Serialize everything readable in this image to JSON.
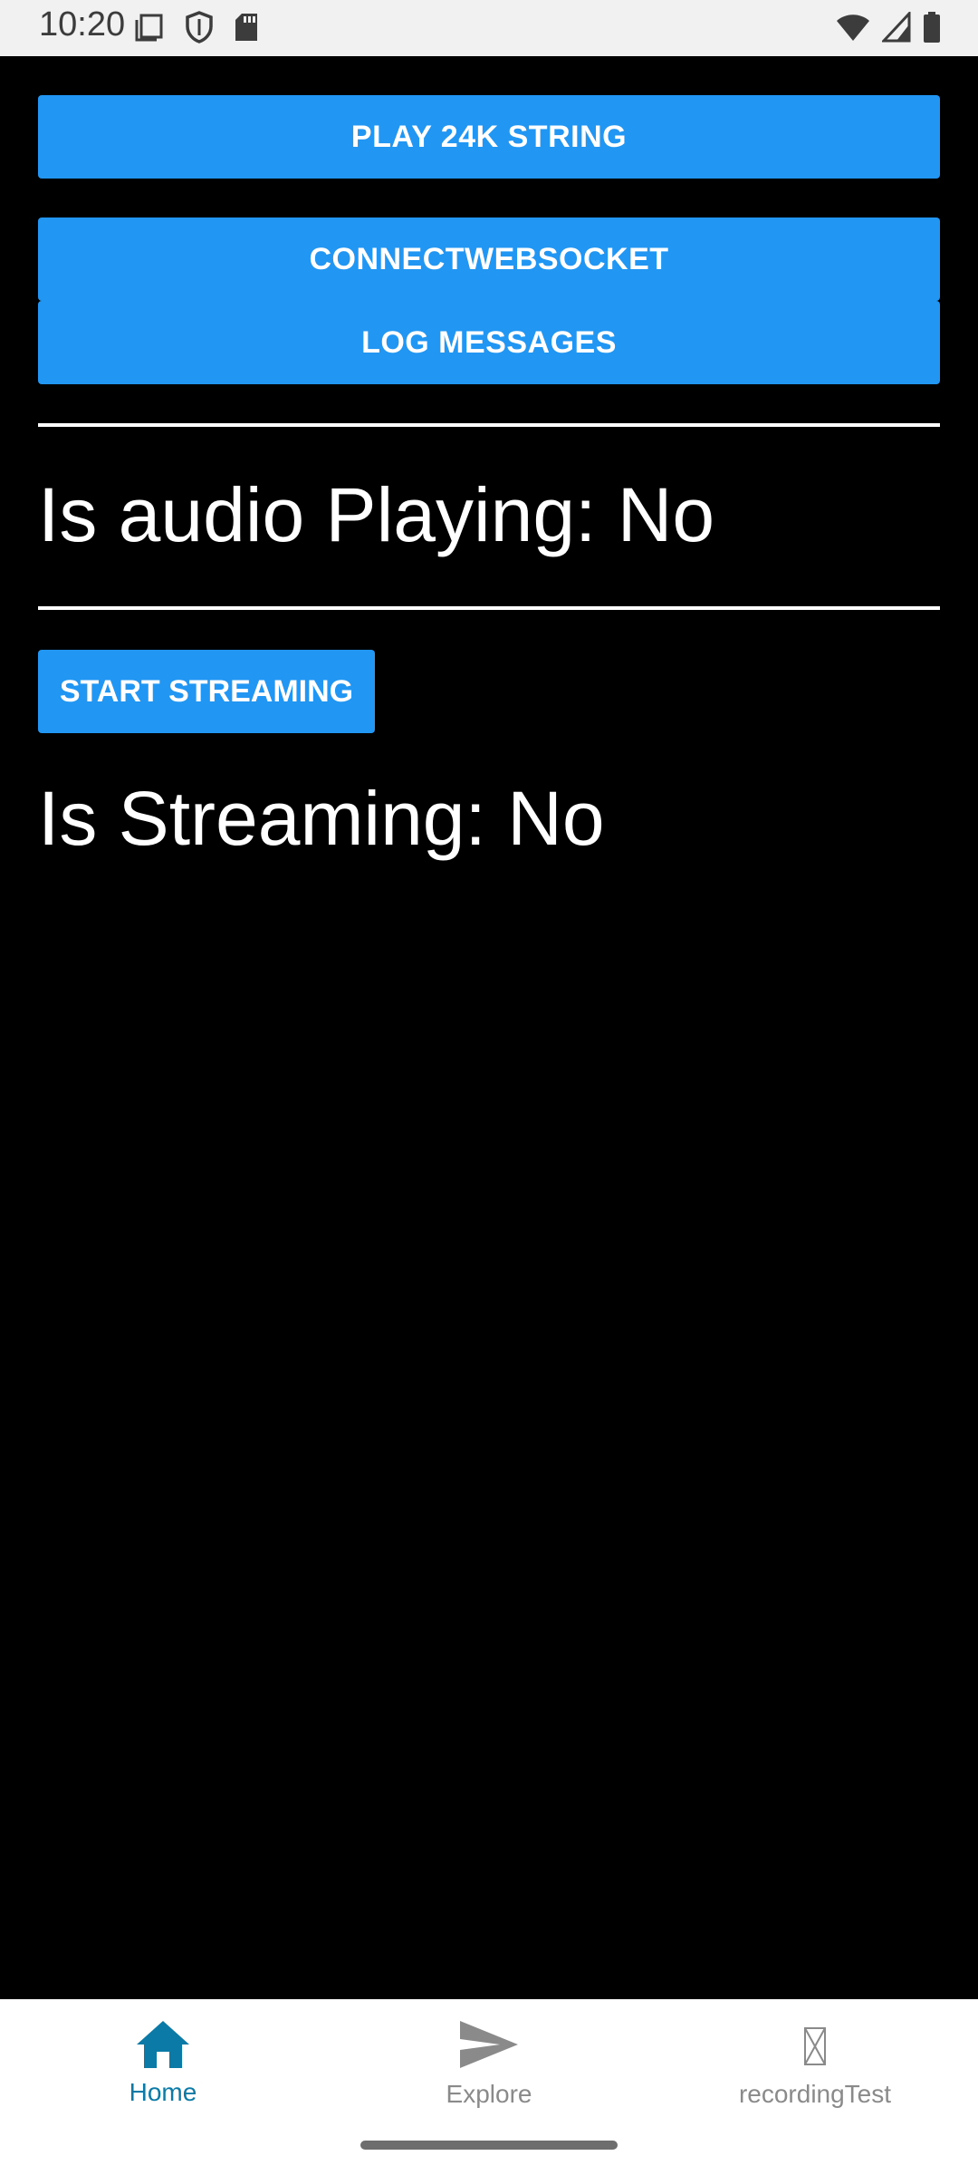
{
  "status_bar": {
    "time": "10:20",
    "left_icons": [
      "screenshot-icon",
      "shield-icon",
      "sd-card-icon"
    ],
    "right_icons": [
      "wifi-icon",
      "cell-signal-icon",
      "battery-icon"
    ]
  },
  "main": {
    "play_button_label": "PLAY 24K STRING",
    "connect_button_label": "CONNECTWEBSOCKET",
    "log_button_label": "LOG MESSAGES",
    "audio_status_text": "Is audio Playing: No",
    "start_streaming_label": "START STREAMING",
    "streaming_status_text": "Is Streaming: No"
  },
  "tabbar": {
    "tabs": [
      {
        "label": "Home",
        "icon": "home-icon",
        "active": true
      },
      {
        "label": "Explore",
        "icon": "send-icon",
        "active": false
      },
      {
        "label": "recordingTest",
        "icon": "missing-image-icon",
        "active": false
      }
    ]
  },
  "colors": {
    "accent": "#2196f3",
    "active_tab": "#0b7aa6",
    "inactive_tab": "#8a8a8a",
    "background": "#000000"
  }
}
